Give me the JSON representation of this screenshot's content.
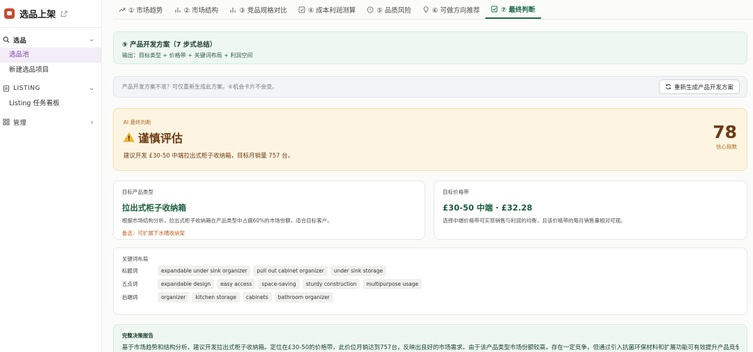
{
  "app": {
    "title": "选品上架"
  },
  "sidebar": {
    "groups": [
      {
        "label": "选品",
        "items": [
          {
            "label": "选品池",
            "active": true
          },
          {
            "label": "新建选品项目",
            "active": false
          }
        ]
      },
      {
        "label": "LISTING",
        "items": [
          {
            "label": "Listing 任务看板",
            "active": false
          }
        ]
      },
      {
        "label": "管理",
        "items": []
      }
    ]
  },
  "tabs": [
    {
      "label": "① 市场趋势",
      "icon": "trend-icon"
    },
    {
      "label": "② 市场结构",
      "icon": "bar-chart-icon"
    },
    {
      "label": "③ 竞品规格对比",
      "icon": "bar-chart-icon"
    },
    {
      "label": "④ 成本利润测算",
      "icon": "checkbox-icon"
    },
    {
      "label": "⑤ 品质风险",
      "icon": "alert-circle-icon"
    },
    {
      "label": "⑥ 可做方向推荐",
      "icon": "lightbulb-icon"
    },
    {
      "label": "⑦ 最终判断",
      "icon": "checkbox-icon",
      "active": true
    }
  ],
  "plan": {
    "title": "⑨ 产品开发方案（7 步式总结）",
    "subtitle": "输出：目标类型 + 价格带 + 关键词布局 + 利润空间"
  },
  "regen": {
    "text": "产品开发方案不准？可仅重新生成此方案。⑥机会卡片不会变。",
    "button_label": "重新生成产品开发方案"
  },
  "verdict": {
    "label": "AI 最终判断",
    "title": "谨慎评估",
    "description": "建议开发 £30-50 中端拉出式柜子收纳箱，目标月销量 757 台。",
    "score": "78",
    "score_label": "信心指数"
  },
  "target": {
    "label": "目标产品类型",
    "title": "拉出式柜子收纳箱",
    "description": "根据市场结构分析，拉出式柜子收纳箱在产品类型中占据60%的市场份额，适合目标客户。",
    "alternative": "备选：可扩展下水槽收纳架"
  },
  "price": {
    "label": "目标价格带",
    "title": "£30-50 中端 · £32.28",
    "description": "选择中端价格带可实现销售与利润的均衡，且该价格带的每月销售量相对可观。"
  },
  "keywords": {
    "label": "关键词布局",
    "rows": [
      {
        "label": "标题词",
        "tags": [
          "expandable under sink organizer",
          "pull out cabinet organizer",
          "under sink storage"
        ]
      },
      {
        "label": "五点词",
        "tags": [
          "expandable design",
          "easy access",
          "space-saving",
          "sturdy construction",
          "multipurpose usage"
        ]
      },
      {
        "label": "后端词",
        "tags": [
          "organizer",
          "kitchen storage",
          "cabinets",
          "bathroom organizer"
        ]
      }
    ]
  },
  "report": {
    "title": "完整决策报告",
    "text": "基于市场趋势和结构分析，建议开发拉出式柜子收纳箱。定位在£30-50的价格带，此价位月销达到757台，反映出良好的市场需求。由于该产品类型市场份额较高，存在一定竞争，但通过引入抗菌环保材料和扩展功能可有效提升产品竞争"
  },
  "colors": {
    "accent": "#1f6b4b",
    "warning": "#6e3b12",
    "active_nav": "#7a3fa8"
  }
}
